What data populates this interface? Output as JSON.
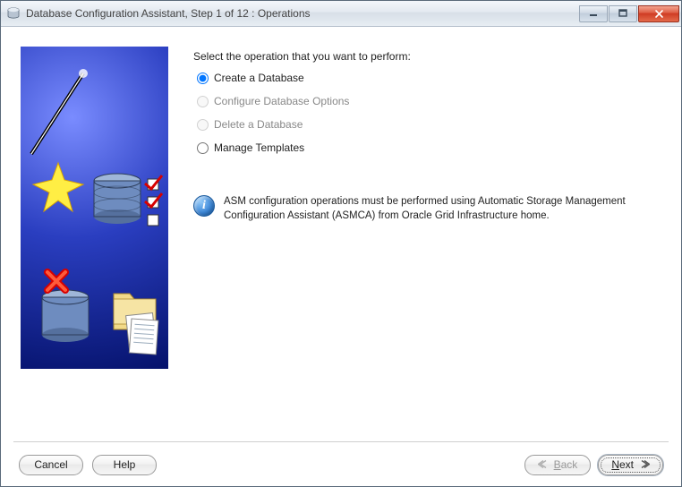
{
  "window": {
    "title": "Database Configuration Assistant, Step 1 of 12 : Operations"
  },
  "main": {
    "prompt": "Select the operation that you want to perform:",
    "options": [
      {
        "label": "Create a Database",
        "enabled": true,
        "selected": true
      },
      {
        "label": "Configure Database Options",
        "enabled": false,
        "selected": false
      },
      {
        "label": "Delete a Database",
        "enabled": false,
        "selected": false
      },
      {
        "label": "Manage Templates",
        "enabled": true,
        "selected": false
      }
    ],
    "info_text": "ASM configuration operations must be performed using Automatic Storage Management Configuration Assistant (ASMCA) from Oracle Grid Infrastructure home."
  },
  "footer": {
    "cancel": "Cancel",
    "help": "Help",
    "back_prefix": "B",
    "back_rest": "ack",
    "next_prefix": "N",
    "next_rest": "ext"
  }
}
